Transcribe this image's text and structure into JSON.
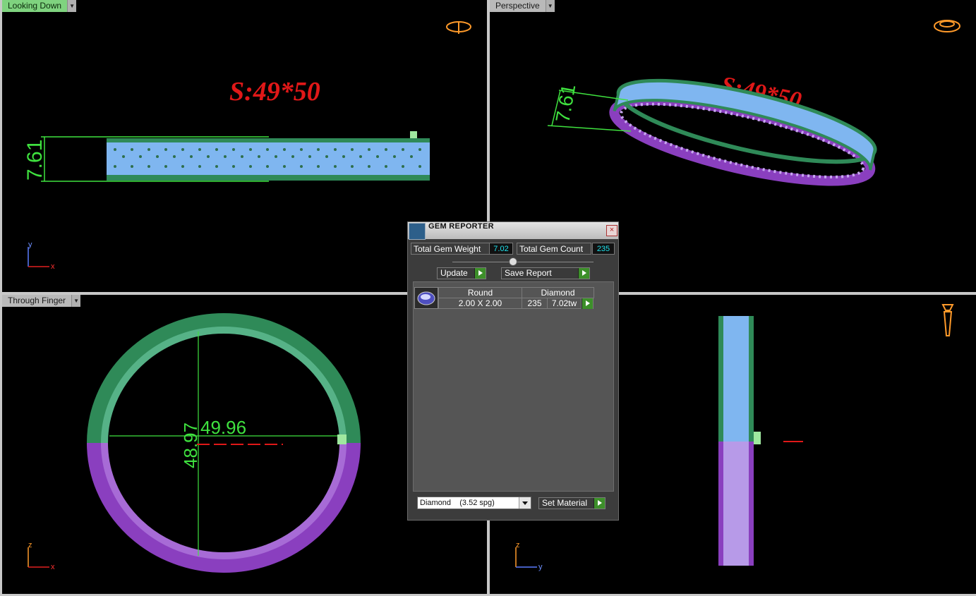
{
  "viewports": {
    "top_left": {
      "label": "Looking Down",
      "axis_a": "y",
      "axis_b": "x"
    },
    "top_right": {
      "label": "Perspective"
    },
    "bottom_left": {
      "label": "Through Finger",
      "axis_a": "z",
      "axis_b": "x"
    },
    "bottom_right": {
      "axis_a": "z",
      "axis_b": "y"
    }
  },
  "annotations": {
    "size_text": "S:49*50",
    "width_dim": "7.61",
    "diameter_horizontal": "49.96",
    "diameter_vertical": "48.97"
  },
  "gem_reporter": {
    "title": "GEM REPORTER",
    "close_icon": "×",
    "total_weight_label": "Total Gem Weight",
    "total_weight_value": "7.02",
    "total_count_label": "Total Gem Count",
    "total_count_value": "235",
    "update_label": "Update",
    "save_report_label": "Save Report",
    "table_headers": [
      "Round",
      "Diamond"
    ],
    "row": {
      "size": "2.00 X 2.00",
      "count": "235",
      "weight": "7.02tw"
    },
    "material_select": "Diamond    (3.52 spg)",
    "set_material_label": "Set Material"
  },
  "colors": {
    "accent_green": "#3d8f2a",
    "value_cyan": "#1ee3ee",
    "ring_blue": "#7fb6f0",
    "ring_green": "#2f8a58",
    "ring_purple": "#8a3fbf",
    "dimension_green": "#3fe23f",
    "text_red": "#e01818"
  }
}
